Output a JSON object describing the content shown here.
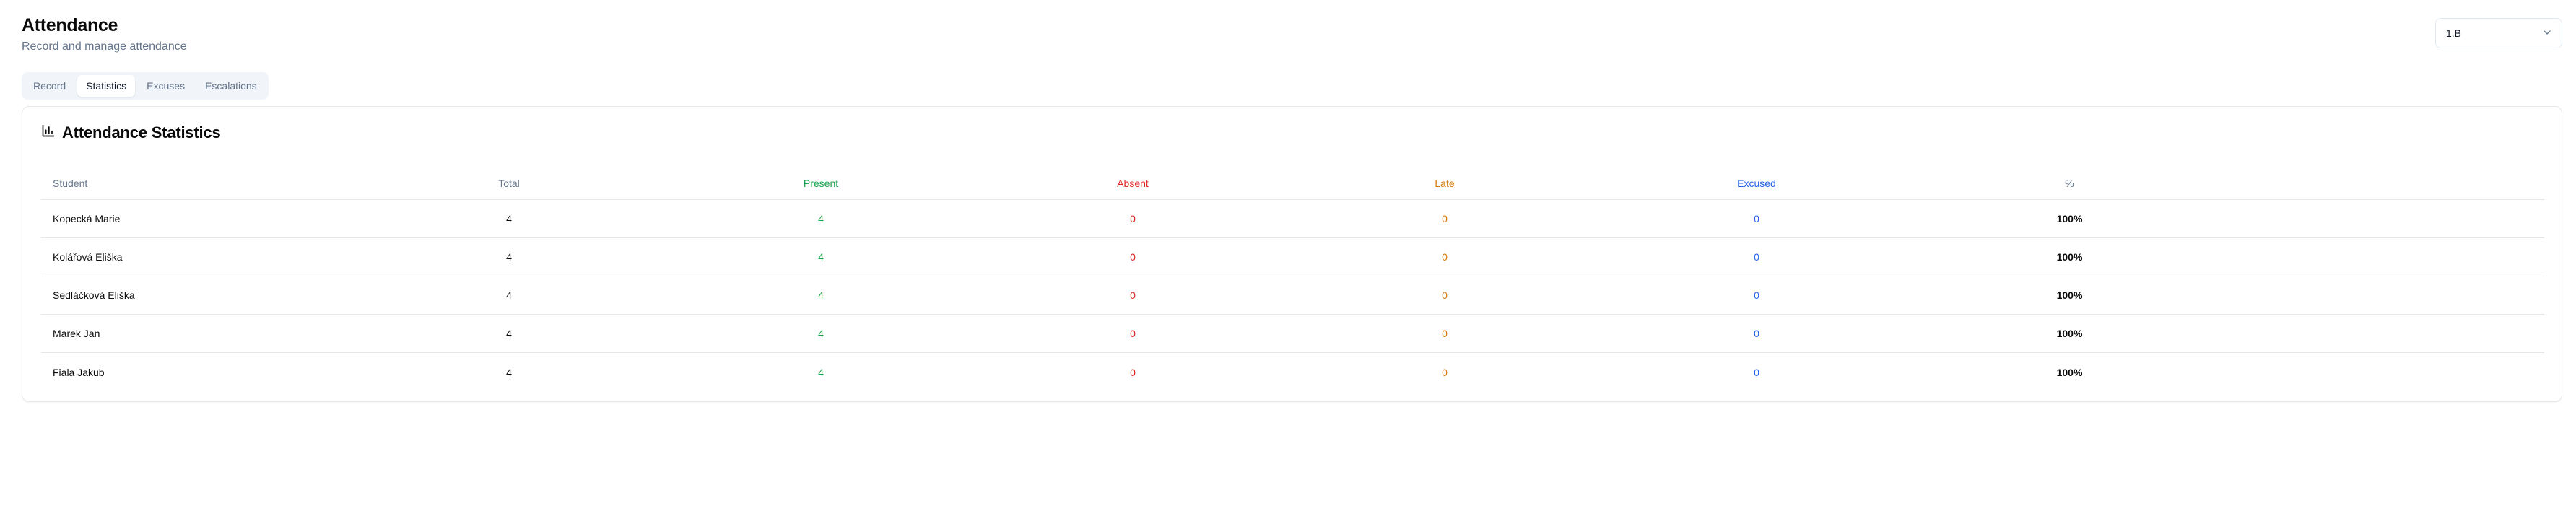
{
  "header": {
    "title": "Attendance",
    "subtitle": "Record and manage attendance"
  },
  "class_select": {
    "value": "1.B",
    "icon": "chevron-down-icon"
  },
  "tabs": [
    {
      "label": "Record",
      "active": false
    },
    {
      "label": "Statistics",
      "active": true
    },
    {
      "label": "Excuses",
      "active": false
    },
    {
      "label": "Escalations",
      "active": false
    }
  ],
  "card": {
    "title": "Attendance Statistics",
    "icon": "bar-chart-icon"
  },
  "table": {
    "columns": [
      "Student",
      "Total",
      "Present",
      "Absent",
      "Late",
      "Excused",
      "%"
    ],
    "rows": [
      {
        "student": "Kopecká Marie",
        "total": "4",
        "present": "4",
        "absent": "0",
        "late": "0",
        "excused": "0",
        "percent": "100%"
      },
      {
        "student": "Kolářová Eliška",
        "total": "4",
        "present": "4",
        "absent": "0",
        "late": "0",
        "excused": "0",
        "percent": "100%"
      },
      {
        "student": "Sedláčková Eliška",
        "total": "4",
        "present": "4",
        "absent": "0",
        "late": "0",
        "excused": "0",
        "percent": "100%"
      },
      {
        "student": "Marek Jan",
        "total": "4",
        "present": "4",
        "absent": "0",
        "late": "0",
        "excused": "0",
        "percent": "100%"
      },
      {
        "student": "Fiala Jakub",
        "total": "4",
        "present": "4",
        "absent": "0",
        "late": "0",
        "excused": "0",
        "percent": "100%"
      }
    ]
  },
  "colors": {
    "present": "#16a34a",
    "absent": "#dc2626",
    "late": "#d97706",
    "excused": "#2563eb"
  }
}
